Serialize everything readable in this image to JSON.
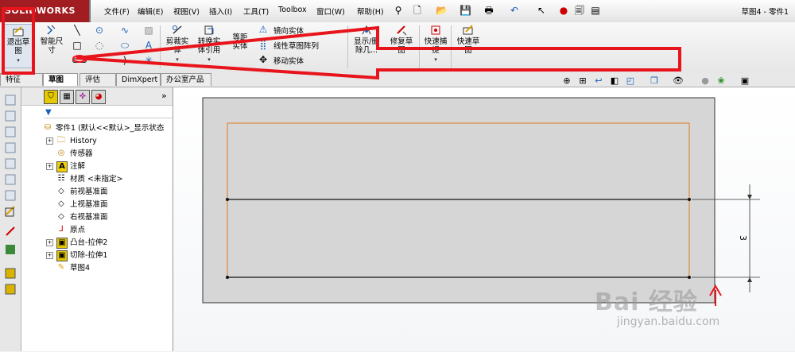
{
  "app": {
    "logo": "SOLIDWORKS",
    "document_title": "草图4 - 零件1"
  },
  "menu": [
    "文件(F)",
    "编辑(E)",
    "视图(V)",
    "插入(I)",
    "工具(T)",
    "Toolbox",
    "窗口(W)",
    "帮助(H)"
  ],
  "command_manager": {
    "exit_sketch": "退出草图",
    "smart_dimension": "智能尺寸",
    "trim": "剪裁实体",
    "convert": "转换实体引用",
    "offset": "等距实体",
    "mirror": "镜向实体",
    "linear_pattern": "线性草图阵列",
    "move": "移动实体",
    "display_delete": "显示/删除几...",
    "repair_sketch": "修复草图",
    "quick_snap": "快速捕捉",
    "rapid_sketch": "快速草图"
  },
  "tabs": [
    "特征",
    "草图",
    "评估",
    "DimXpert",
    "办公室产品"
  ],
  "tree": {
    "root": "零件1 (默认<<默认>_显示状态",
    "items": [
      "History",
      "传感器",
      "注解",
      "材质 <未指定>",
      "前视基准面",
      "上视基准面",
      "右视基准面",
      "原点",
      "凸台-拉伸2",
      "切除-拉伸1",
      "草图4"
    ]
  },
  "sketch": {
    "dimension_label": "3"
  },
  "watermark": {
    "main": "Bai 经验",
    "sub": "jingyan.baidu.com"
  },
  "colors": {
    "annotation_red": "#e8141c",
    "sketch_orange": "#e07a1e",
    "brand": "#a11d21"
  }
}
